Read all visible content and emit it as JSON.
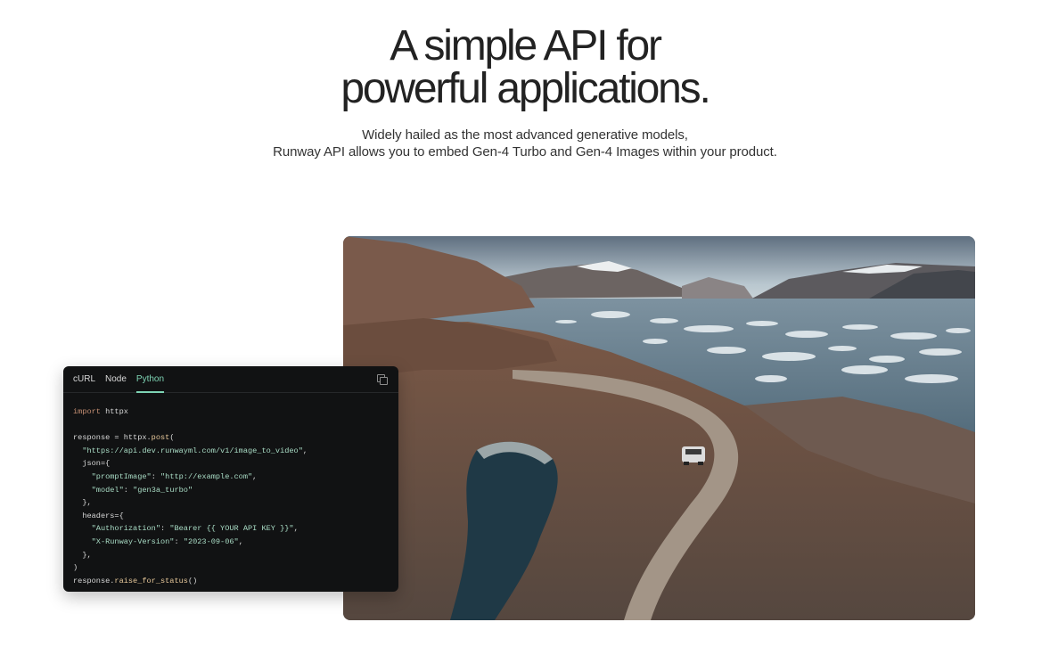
{
  "hero": {
    "title_line1": "A simple API for",
    "title_line2": "powerful applications.",
    "subtitle_line1": "Widely hailed as the most advanced generative models,",
    "subtitle_line2": "Runway API allows you to embed Gen-4 Turbo and Gen-4 Images within your product."
  },
  "code_card": {
    "tabs": [
      {
        "label": "cURL",
        "active": false
      },
      {
        "label": "Node",
        "active": false
      },
      {
        "label": "Python",
        "active": true
      }
    ],
    "copy_icon": "copy-icon",
    "lines": [
      [
        {
          "t": "import",
          "c": "kw"
        },
        {
          "t": " httpx",
          "c": "pn"
        }
      ],
      [],
      [
        {
          "t": "response = httpx.",
          "c": "pn"
        },
        {
          "t": "post",
          "c": "fn"
        },
        {
          "t": "(",
          "c": "pn"
        }
      ],
      [
        {
          "t": "  ",
          "c": "pn"
        },
        {
          "t": "\"https://api.dev.runwayml.com/v1/image_to_video\"",
          "c": "str"
        },
        {
          "t": ",",
          "c": "pn"
        }
      ],
      [
        {
          "t": "  json={",
          "c": "pn"
        }
      ],
      [
        {
          "t": "    ",
          "c": "pn"
        },
        {
          "t": "\"promptImage\"",
          "c": "str"
        },
        {
          "t": ": ",
          "c": "pn"
        },
        {
          "t": "\"http://example.com\"",
          "c": "str"
        },
        {
          "t": ",",
          "c": "pn"
        }
      ],
      [
        {
          "t": "    ",
          "c": "pn"
        },
        {
          "t": "\"model\"",
          "c": "str"
        },
        {
          "t": ": ",
          "c": "pn"
        },
        {
          "t": "\"gen3a_turbo\"",
          "c": "str"
        }
      ],
      [
        {
          "t": "  },",
          "c": "pn"
        }
      ],
      [
        {
          "t": "  headers={",
          "c": "pn"
        }
      ],
      [
        {
          "t": "    ",
          "c": "pn"
        },
        {
          "t": "\"Authorization\"",
          "c": "str"
        },
        {
          "t": ": ",
          "c": "pn"
        },
        {
          "t": "\"Bearer {{ YOUR API KEY }}\"",
          "c": "str"
        },
        {
          "t": ",",
          "c": "pn"
        }
      ],
      [
        {
          "t": "    ",
          "c": "pn"
        },
        {
          "t": "\"X-Runway-Version\"",
          "c": "str"
        },
        {
          "t": ": ",
          "c": "pn"
        },
        {
          "t": "\"2023-09-06\"",
          "c": "str"
        },
        {
          "t": ",",
          "c": "pn"
        }
      ],
      [
        {
          "t": "  },",
          "c": "pn"
        }
      ],
      [
        {
          "t": ")",
          "c": "pn"
        }
      ],
      [
        {
          "t": "response.",
          "c": "pn"
        },
        {
          "t": "raise_for_status",
          "c": "fn"
        },
        {
          "t": "()",
          "c": "pn"
        }
      ]
    ]
  },
  "colors": {
    "code_background": "#111213",
    "active_tab": "#7ed4b4",
    "keyword": "#c58f73",
    "string": "#a9dcc5",
    "function": "#e7c89a"
  }
}
